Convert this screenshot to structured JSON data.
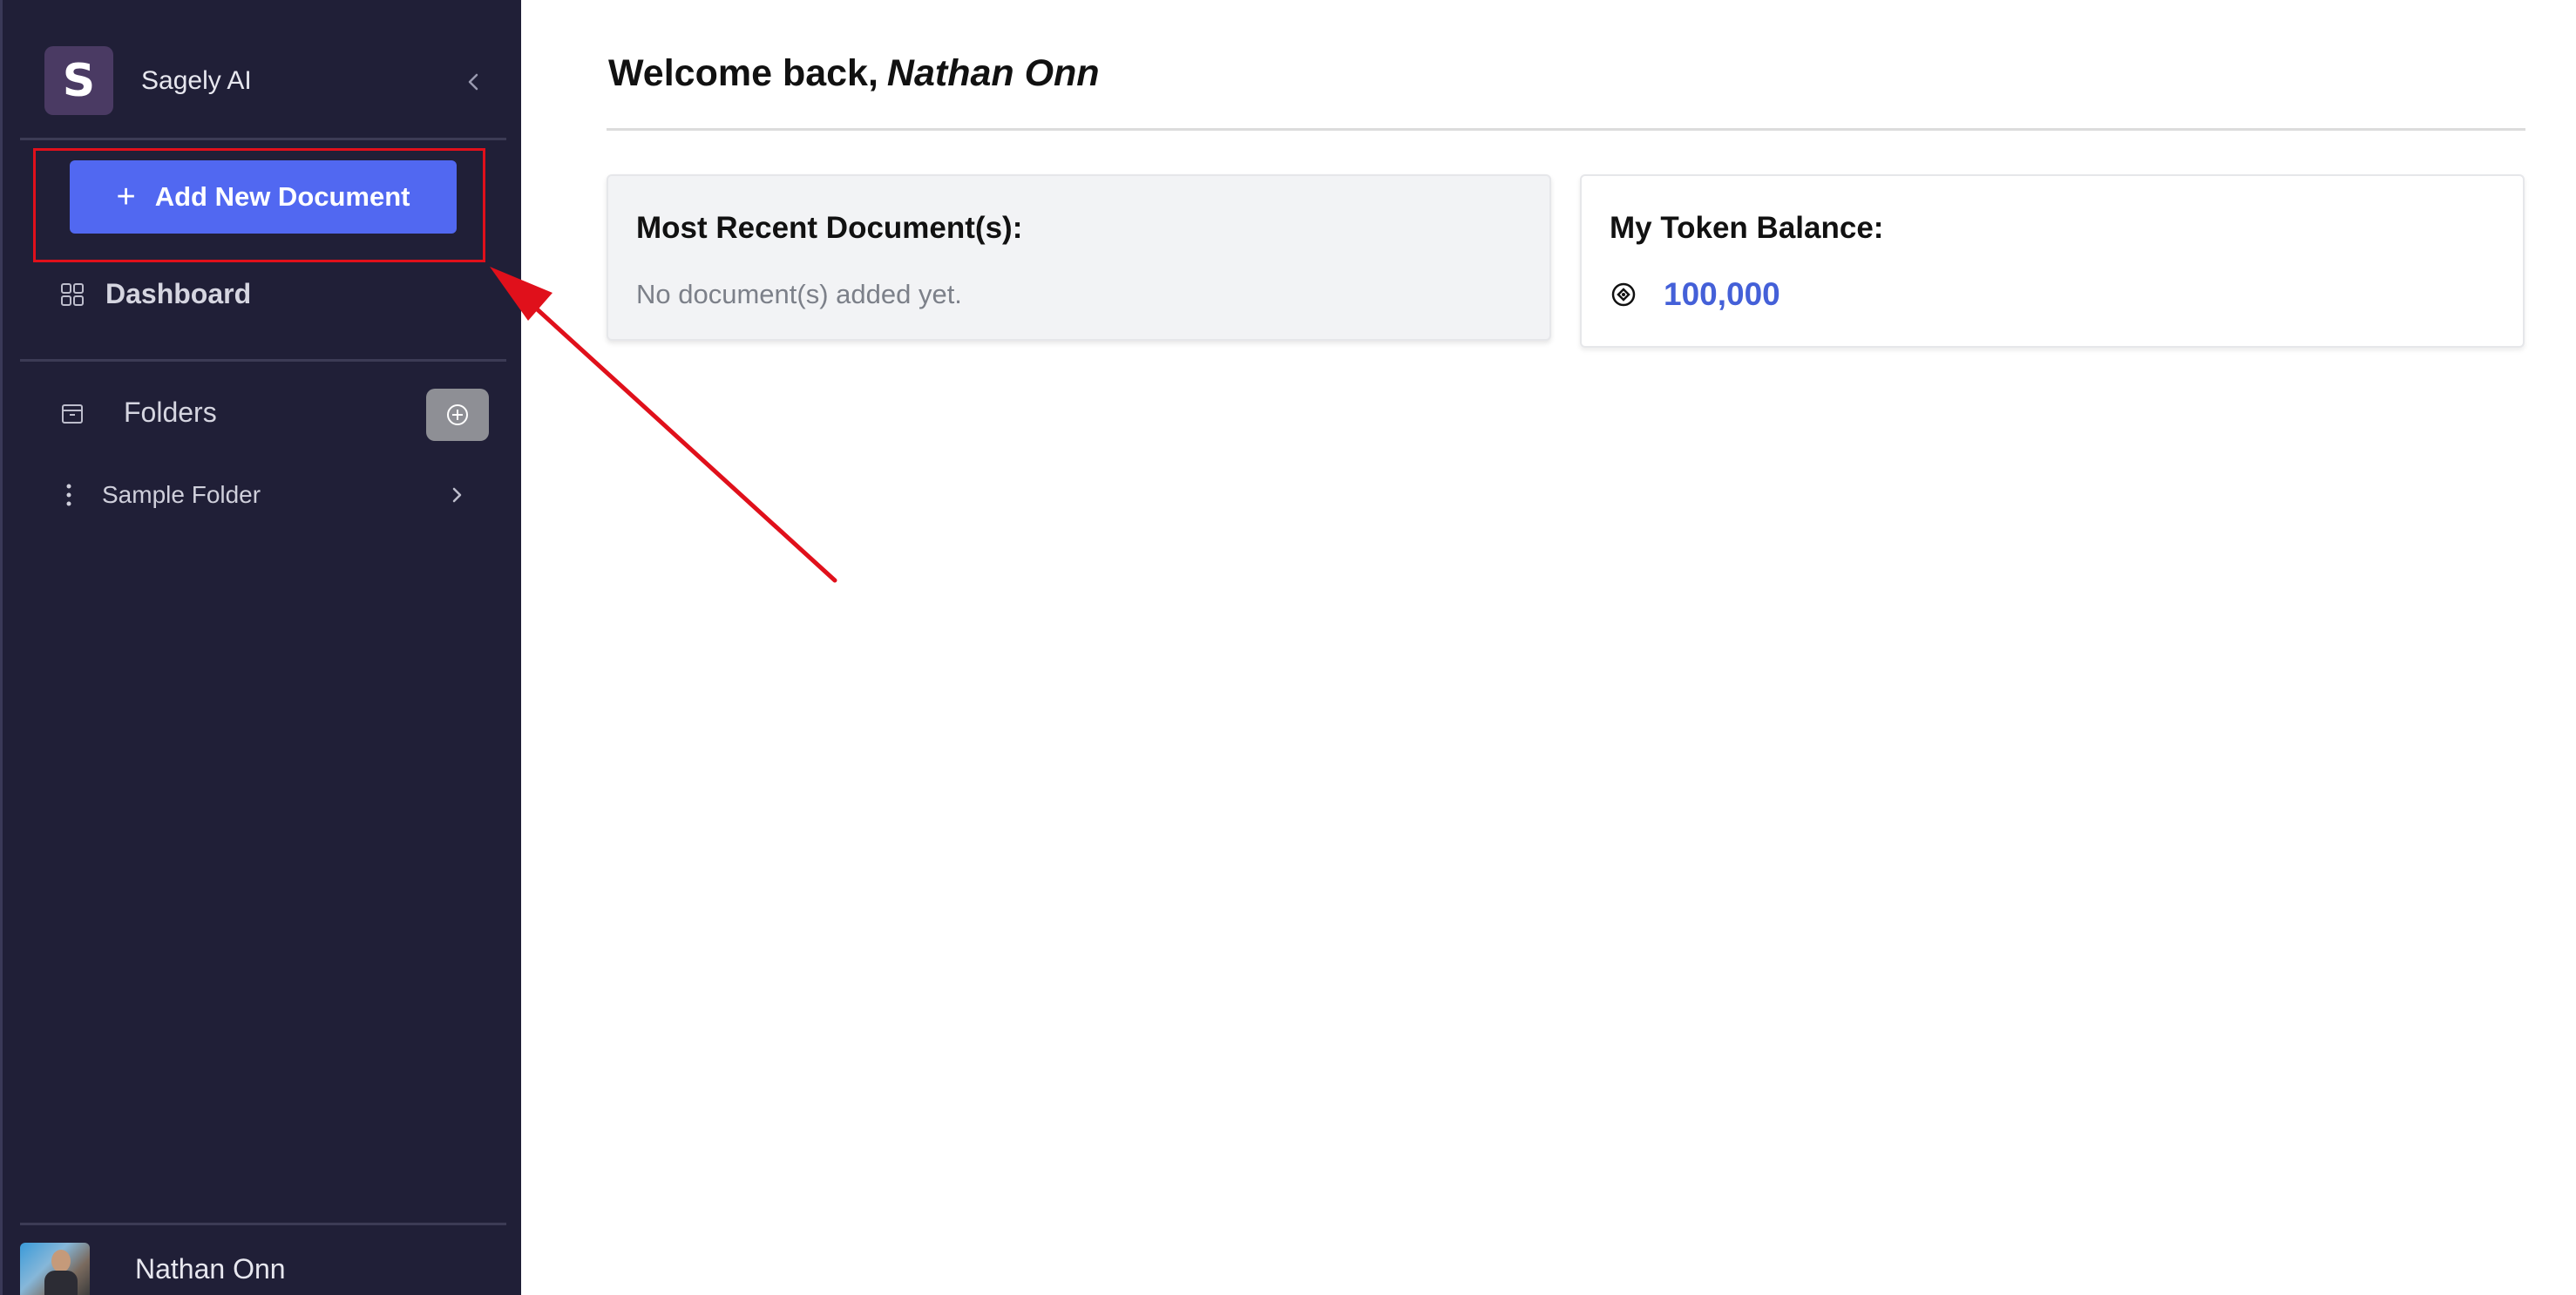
{
  "sidebar": {
    "brand": {
      "logo_letter": "S",
      "name": "Sagely AI"
    },
    "add_document_label": "Add New Document",
    "nav": {
      "dashboard_label": "Dashboard",
      "folders_label": "Folders"
    },
    "folders": [
      {
        "name": "Sample Folder"
      }
    ],
    "user": {
      "name": "Nathan Onn"
    }
  },
  "main": {
    "welcome_prefix": "Welcome back,",
    "welcome_name": "Nathan Onn",
    "recent_card": {
      "title": "Most Recent Document(s):",
      "empty_text": "No document(s) added yet."
    },
    "token_card": {
      "title": "My Token Balance:",
      "value": "100,000"
    }
  },
  "colors": {
    "sidebar_bg": "#201f37",
    "primary_button": "#5168f1",
    "highlight": "#e0101b",
    "token_value": "#4460d8"
  },
  "icons": [
    "collapse-chevron-icon",
    "plus-icon",
    "dashboard-grid-icon",
    "folder-icon",
    "add-circle-icon",
    "kebab-menu-icon",
    "chevron-right-icon",
    "token-coin-icon"
  ]
}
